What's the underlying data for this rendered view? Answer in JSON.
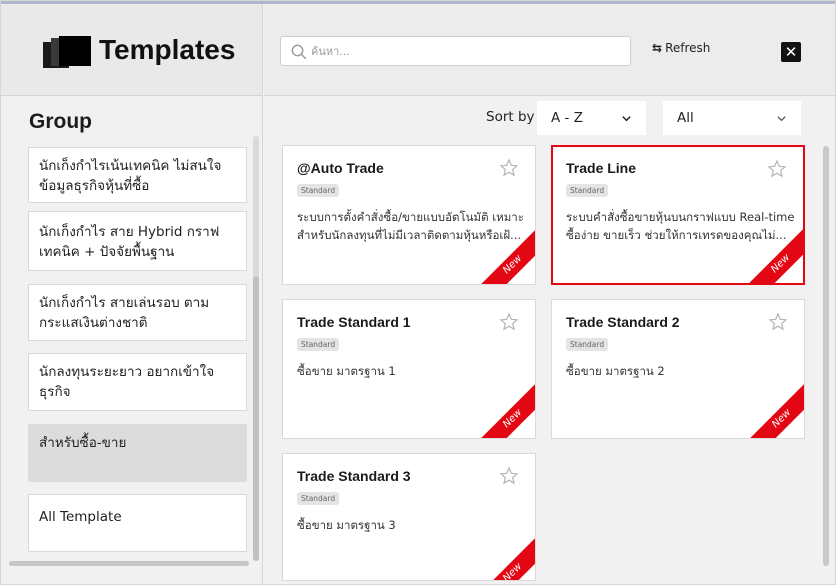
{
  "header": {
    "title": "Templates",
    "search_placeholder": "ค้นหา...",
    "refresh_label": "Refresh",
    "close_label": "✕"
  },
  "group": {
    "title": "Group",
    "items": [
      {
        "label": "นักเก็งกำไรเน้นเทคนิค ไม่สนใจข้อมูลธุรกิจหุ้นที่ซื้อ",
        "active": false
      },
      {
        "label": "นักเก็งกำไร สาย Hybrid กราฟเทคนิค + ปัจจัยพื้นฐาน",
        "active": false
      },
      {
        "label": "นักเก็งกำไร สายเล่นรอบ ตามกระแสเงินต่างชาติ",
        "active": false
      },
      {
        "label": "นักลงทุนระยะยาว อยากเข้าใจธุรกิจ",
        "active": false
      },
      {
        "label": "สำหรับซื้อ-ขาย",
        "active": true
      },
      {
        "label": "All Template",
        "active": false
      }
    ]
  },
  "toolbar": {
    "sort_label": "Sort by",
    "sort_value": "A - Z",
    "filter_value": "All"
  },
  "cards": [
    {
      "title": "@Auto Trade",
      "badge": "Standard",
      "desc": "ระบบการตั้งคำสั่งซื้อ/ขายแบบอัตโนมัติ เหมาะสำหรับนักลงทุนที่ไม่มีเวลาติดตามหุ้นหรือเฝ้...",
      "ribbon": "New",
      "selected": false
    },
    {
      "title": "Trade Line",
      "badge": "Standard",
      "desc": "ระบบคำสั่งซื้อขายหุ้นบนกราฟแบบ Real-time ซื้อง่าย ขายเร็ว ช่วยให้การเทรดของคุณไม่...",
      "ribbon": "New",
      "selected": true
    },
    {
      "title": "Trade Standard 1",
      "badge": "Standard",
      "desc": "ซื้อขาย มาตรฐาน 1",
      "ribbon": "New",
      "selected": false
    },
    {
      "title": "Trade Standard 2",
      "badge": "Standard",
      "desc": "ซื้อขาย มาตรฐาน 2",
      "ribbon": "New",
      "selected": false
    },
    {
      "title": "Trade Standard 3",
      "badge": "Standard",
      "desc": "ซื้อขาย มาตรฐาน 3",
      "ribbon": "New",
      "selected": false
    }
  ],
  "colors": {
    "accent": "#e30613",
    "active_group": "#dcdcdc"
  }
}
